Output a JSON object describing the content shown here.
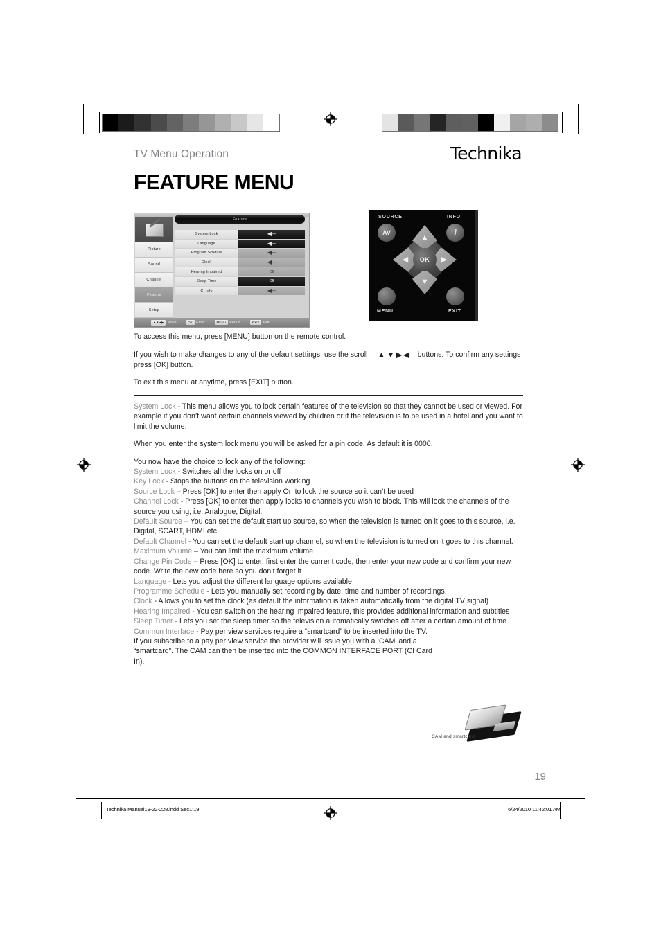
{
  "header": {
    "section_title": "TV Menu Operation",
    "brand": "Technika",
    "page_heading": "FEATURE MENU"
  },
  "osd": {
    "title": "Feature",
    "sidebar": [
      {
        "label": "Picture",
        "active": false
      },
      {
        "label": "Sound",
        "active": false
      },
      {
        "label": "Channel",
        "active": false
      },
      {
        "label": "Feature",
        "active": true
      },
      {
        "label": "Setup",
        "active": false
      }
    ],
    "rows": [
      {
        "label": "System Lock",
        "value": "◀—",
        "selected": true
      },
      {
        "label": "Language",
        "value": "◀—",
        "selected": true
      },
      {
        "label": "Program Schdule",
        "value": "◀—",
        "selected": false
      },
      {
        "label": "Clock",
        "value": "◀—",
        "selected": false
      },
      {
        "label": "Hearing Impaired",
        "value": "Off",
        "selected": false
      },
      {
        "label": "Sleep Time",
        "value": "Off",
        "selected": true
      },
      {
        "label": "CI Info",
        "value": "◀—",
        "selected": false
      }
    ],
    "hints": [
      {
        "key": "▲▼◀▶",
        "text": "Move"
      },
      {
        "key": "OK",
        "text": "Enter"
      },
      {
        "key": "MENU",
        "text": "Return"
      },
      {
        "key": "EXIT",
        "text": "Exit"
      }
    ]
  },
  "remote": {
    "source_label": "SOURCE",
    "info_label": "INFO",
    "menu_label": "MENU",
    "exit_label": "EXIT",
    "av_button": "AV",
    "info_button": "i",
    "ok_button": "OK",
    "up_arrow": "▲",
    "down_arrow": "▼",
    "left_arrow": "◀",
    "right_arrow": "▶"
  },
  "body": {
    "intro_1": "To access this menu, press [MENU] button on the remote control.",
    "intro_2a": "If you wish to make changes to any of the default settings, use the scroll",
    "intro_arrows": "▲▼▶◀",
    "intro_2b": "buttons. To confirm any settings press [OK] button.",
    "intro_3": "To exit this menu at anytime, press [EXIT] button.",
    "system_lock_term": "System Lock",
    "system_lock_desc": " - This menu allows you to lock certain features of the television so that they cannot be used or viewed. For example if you don’t want certain channels viewed by children or if the television is to be used in a hotel and you want to limit the volume.",
    "pin_note": "When you enter the system lock menu you will be asked for a pin code. As default it is 0000.",
    "choice_intro": "You now have the choice to lock any of the following:",
    "items": [
      {
        "term": "System Lock",
        "desc": " - Switches all the locks on or off"
      },
      {
        "term": "Key Lock",
        "desc": " - Stops the buttons on the television working"
      },
      {
        "term": "Source Lock",
        "desc": " – Press [OK] to enter then apply On to lock the source so it can’t be used"
      },
      {
        "term": "Channel Lock",
        "desc": " - Press [OK] to enter then apply locks to channels you wish to block. This will lock the channels of the source you using, i.e. Analogue, Digital."
      },
      {
        "term": "Default Source",
        "desc": " – You can set the default start up source, so when the television is turned on it goes to this source, i.e. Digital, SCART, HDMI etc"
      },
      {
        "term": "Default Channel",
        "desc": " - You can set the default start up channel, so when the television is turned on it goes to this channel."
      },
      {
        "term": "Maximum Volume",
        "desc": " – You can limit the maximum volume"
      }
    ],
    "pin_term": "Change Pin Code",
    "pin_desc": " – Press [OK] to enter, first enter the current code, then enter your new code and confirm your new code. Write the new code here so you don’t forget it",
    "items2": [
      {
        "term": "Language",
        "desc": " - Lets you adjust the different language options available"
      },
      {
        "term": "Programme Schedule",
        "desc": " - Lets you manually set recording by date, time and number of recordings."
      },
      {
        "term": "Clock",
        "desc": " - Allows you to set the clock (as default the information is taken automatically from the digital TV signal)"
      },
      {
        "term": "Hearing Impaired",
        "desc": " - You can switch on the hearing impaired feature, this provides additional information and subtitles"
      },
      {
        "term": "Sleep Timer",
        "desc": " - Lets you set the sleep timer so the television automatically switches off after a certain amount of time"
      },
      {
        "term": "Common Interface",
        "desc": " - Pay per view services require a “smartcard” to be inserted into the TV."
      }
    ],
    "ci_para": "If you subscribe to a pay per view service the provider will issue you with a ‘CAM’ and a “smartcard”. The CAM can then be inserted into the COMMON INTERFACE PORT (CI Card In)."
  },
  "cam_caption": "CAM and smartcard",
  "page_number": "19",
  "footer": {
    "left": "Technika Manual19-22-228.indd   Sec1:19",
    "right": "6/24/2010   11:42:01 AM"
  },
  "colorbars": {
    "left": [
      "#000000",
      "#1b1b1b",
      "#323232",
      "#4b4b4b",
      "#636363",
      "#7d7d7d",
      "#969696",
      "#b0b0b0",
      "#c8c8c8",
      "#e6e6e6",
      "#ffffff"
    ],
    "right": [
      "#e4e4e4",
      "#5a5a5a",
      "#767676",
      "#252525",
      "#5e5e5e",
      "#606060",
      "#000000",
      "#f0f0f0",
      "#a5a5a5",
      "#aeaeae",
      "#8c8c8c"
    ]
  }
}
